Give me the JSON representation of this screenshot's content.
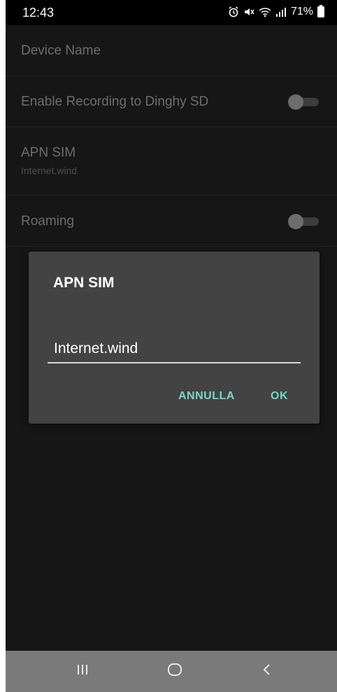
{
  "status_bar": {
    "time": "12:43",
    "battery": "71%"
  },
  "settings": {
    "device_name": {
      "label": "Device Name"
    },
    "recording": {
      "label": "Enable Recording to Dinghy SD",
      "enabled": false
    },
    "apn": {
      "label": "APN SIM",
      "value": "Internet.wind"
    },
    "roaming": {
      "label": "Roaming",
      "enabled": false
    }
  },
  "dialog": {
    "title": "APN SIM",
    "input_value": "Internet.wind",
    "cancel_label": "ANNULLA",
    "ok_label": "OK",
    "accent_color": "#7fd3c8"
  },
  "nav_bar": {
    "recent_icon": "recent-apps-icon",
    "home_icon": "home-icon",
    "back_icon": "back-icon"
  }
}
